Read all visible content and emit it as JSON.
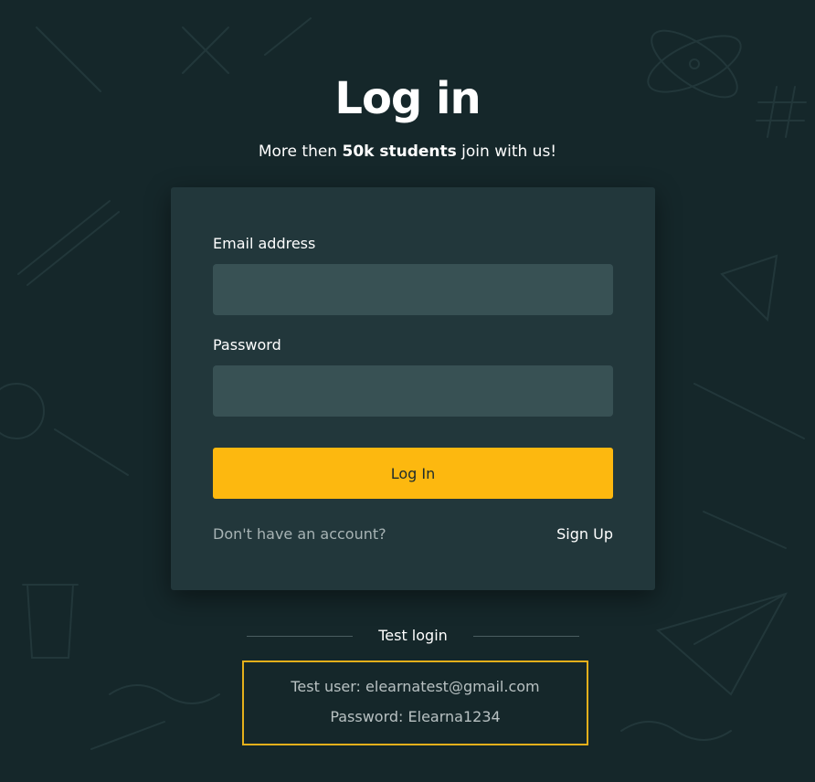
{
  "header": {
    "title": "Log in",
    "subtitle_prefix": "More then ",
    "subtitle_bold": "50k students",
    "subtitle_suffix": " join with us!"
  },
  "form": {
    "email_label": "Email address",
    "email_value": "",
    "password_label": "Password",
    "password_value": "",
    "submit_label": "Log In",
    "no_account_text": "Don't have an account?",
    "signup_label": "Sign Up"
  },
  "test_login": {
    "heading": "Test login",
    "user_line": "Test user: elearnatest@gmail.com",
    "password_line": "Password: Elearna1234"
  },
  "colors": {
    "background": "#15272a",
    "card": "#22373b",
    "input": "#385154",
    "accent": "#fdb80f",
    "muted_text": "#a7b3b4"
  },
  "icons": {
    "background_pattern": "education-doodle-pattern"
  }
}
